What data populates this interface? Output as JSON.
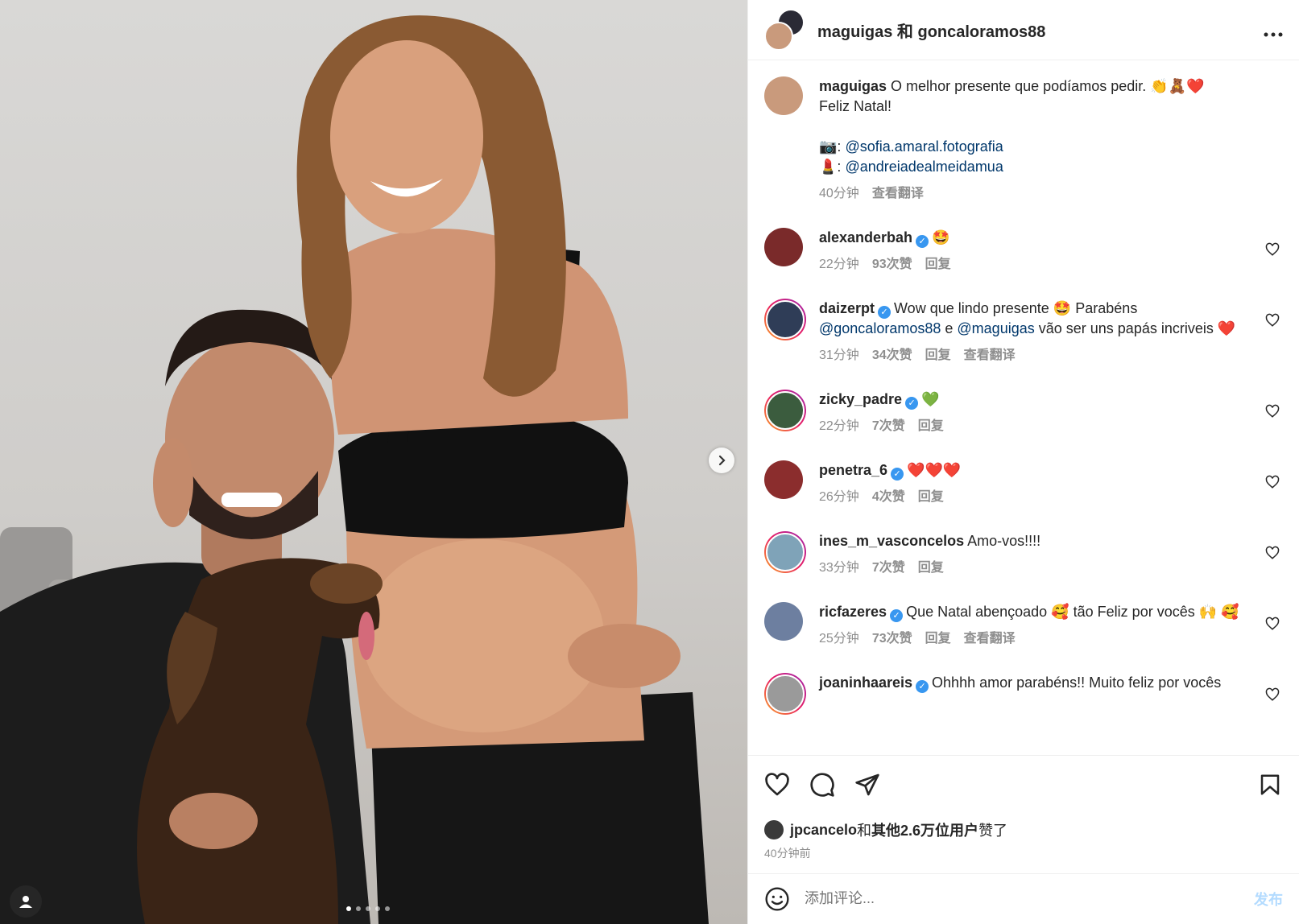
{
  "header": {
    "title": "maguigas 和 goncaloramos88",
    "more_icon": "more-horizontal-icon"
  },
  "caption": {
    "username": "maguigas",
    "text": "O melhor presente que podíamos pedir.",
    "emojis": "👏🧸❤️",
    "line2": "Feliz Natal!",
    "credit1_icon": "📷",
    "credit1_mention": "@sofia.amaral.fotografia",
    "credit2_icon": "💄",
    "credit2_mention": "@andreiadealmeidamua",
    "time": "40分钟",
    "translate": "查看翻译"
  },
  "comments": [
    {
      "username": "alexanderbah",
      "verified": true,
      "text": "",
      "emoji": "🤩",
      "time": "22分钟",
      "likes": "93次赞",
      "reply": "回复",
      "translate": ""
    },
    {
      "username": "daizerpt",
      "verified": true,
      "text": "Wow que lindo presente",
      "emoji": "🤩",
      "text2": "Parabéns",
      "mention1": "@goncaloramos88",
      "conj": "e",
      "mention2": "@maguigas",
      "text3": "vão ser uns papás incriveis",
      "emoji2": "❤️",
      "time": "31分钟",
      "likes": "34次赞",
      "reply": "回复",
      "translate": "查看翻译"
    },
    {
      "username": "zicky_padre",
      "verified": true,
      "text": "",
      "emoji": "💚",
      "time": "22分钟",
      "likes": "7次赞",
      "reply": "回复",
      "translate": ""
    },
    {
      "username": "penetra_6",
      "verified": true,
      "text": "",
      "emoji": "❤️❤️❤️",
      "time": "26分钟",
      "likes": "4次赞",
      "reply": "回复",
      "translate": ""
    },
    {
      "username": "ines_m_vasconcelos",
      "verified": false,
      "text": "Amo-vos!!!!",
      "emoji": "",
      "time": "33分钟",
      "likes": "7次赞",
      "reply": "回复",
      "translate": ""
    },
    {
      "username": "ricfazeres",
      "verified": true,
      "text": "Que Natal abençoado",
      "emoji": "🥰",
      "text2": "tão Feliz por vocês",
      "emoji2": "🙌",
      "emoji3": "🥰",
      "time": "25分钟",
      "likes": "73次赞",
      "reply": "回复",
      "translate": "查看翻译"
    },
    {
      "username": "joaninhaareis",
      "verified": true,
      "text": "Ohhhh amor parabéns!! Muito feliz por vocês",
      "emoji": "",
      "time": "",
      "likes": "",
      "reply": "",
      "translate": ""
    }
  ],
  "likes": {
    "user": "jpcancelo",
    "and": "和",
    "others": "其他2.6万位用户",
    "suffix": "赞了",
    "time": "40分钟前"
  },
  "composer": {
    "placeholder": "添加评论...",
    "post_label": "发布"
  },
  "colors": {
    "link": "#00376b",
    "verified": "#3897f0",
    "muted": "#8e8e8e",
    "post_disabled": "#b3dbff"
  }
}
